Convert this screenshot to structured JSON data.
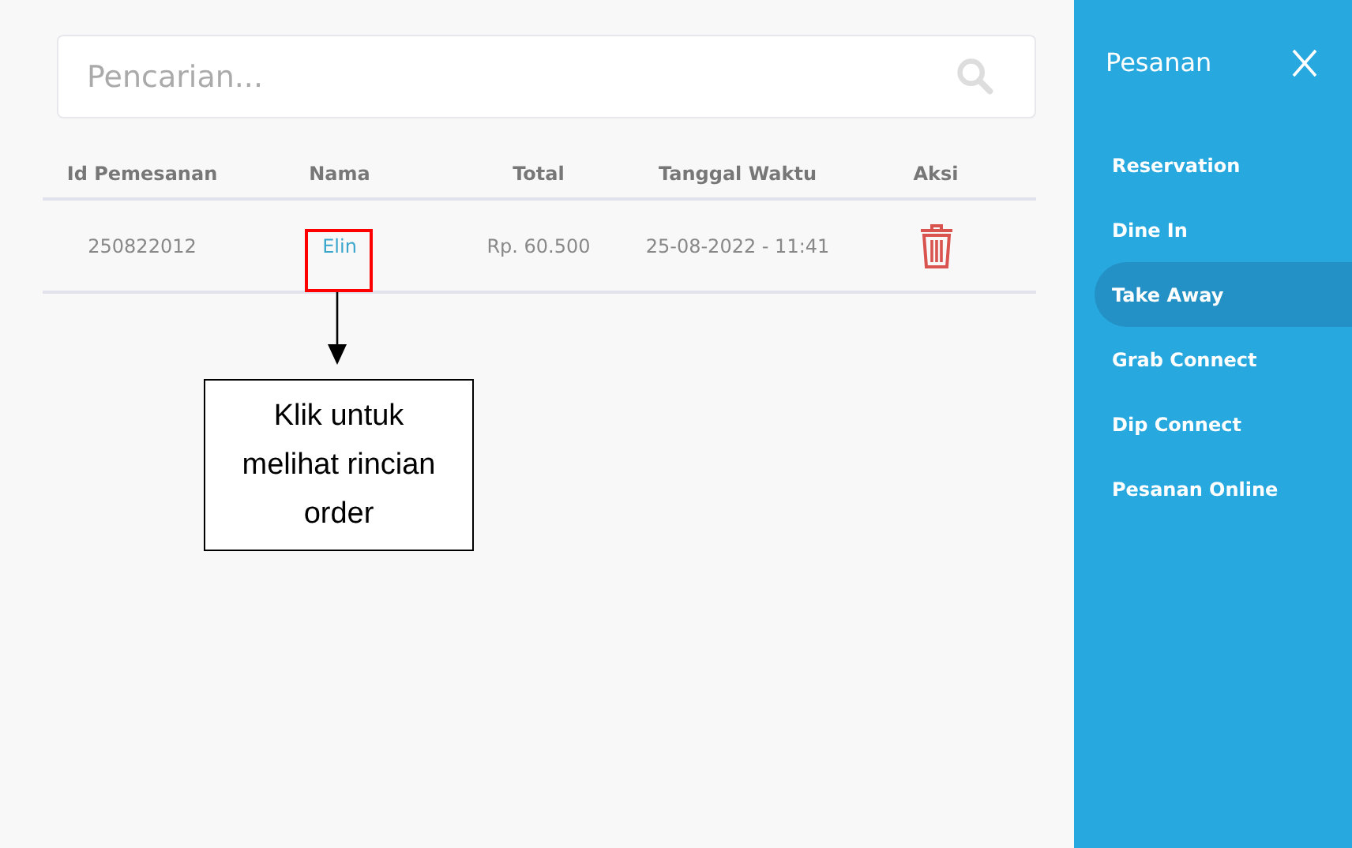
{
  "search": {
    "placeholder": "Pencarian..."
  },
  "table": {
    "columns": [
      "Id Pemesanan",
      "Nama",
      "Total",
      "Tanggal Waktu",
      "Aksi"
    ],
    "rows": [
      {
        "id": "250822012",
        "name": "Elin",
        "total": "Rp. 60.500",
        "datetime": "25-08-2022 - 11:41"
      }
    ]
  },
  "annotation": {
    "text": "Klik untuk melihat rincian order"
  },
  "sidebar": {
    "title": "Pesanan",
    "items": [
      {
        "label": "Reservation",
        "selected": false
      },
      {
        "label": "Dine In",
        "selected": false
      },
      {
        "label": "Take Away",
        "selected": true
      },
      {
        "label": "Grab Connect",
        "selected": false
      },
      {
        "label": "Dip Connect",
        "selected": false
      },
      {
        "label": "Pesanan Online",
        "selected": false
      }
    ]
  }
}
